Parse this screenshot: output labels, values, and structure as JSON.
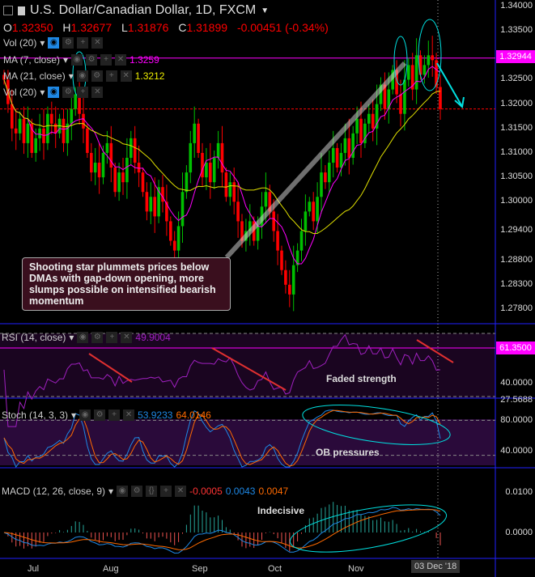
{
  "header": {
    "title": "U.S. Dollar/Canadian Dollar, 1D, FXCM",
    "open_label": "O",
    "open": "1.32350",
    "high_label": "H",
    "high": "1.32677",
    "low_label": "L",
    "low": "1.31876",
    "close_label": "C",
    "close": "1.31899",
    "change": "-0.00451 (-0.34%)"
  },
  "indicators": {
    "vol1": "Vol (20)",
    "ma7": "MA (7, close)",
    "ma7_val": "1.3259",
    "ma21": "MA (21, close)",
    "ma21_val": "1.3212",
    "vol2": "Vol (20)",
    "rsi": "RSI (14, close)",
    "rsi_val": "49.9004",
    "stoch": "Stoch (14, 3, 3)",
    "stoch_k": "53.9233",
    "stoch_d": "64.0146",
    "macd": "MACD (12, 26, close, 9)",
    "macd_hist": "-0.0005",
    "macd_line": "0.0043",
    "macd_signal": "0.0047"
  },
  "price_axis": [
    "1.34000",
    "1.33500",
    "1.32500",
    "1.32000",
    "1.31500",
    "1.31000",
    "1.30500",
    "1.30000",
    "1.29400",
    "1.28800",
    "1.28300",
    "1.27800"
  ],
  "price_tag": "1.32944",
  "rsi_axis": {
    "tag": "61.3500",
    "mid": "40.0000",
    "low": "27.5688"
  },
  "stoch_axis": [
    "80.0000",
    "40.0000"
  ],
  "macd_axis": [
    "0.0100",
    "0.0000"
  ],
  "time_axis": {
    "months": [
      "Jul",
      "Aug",
      "Sep",
      "Oct",
      "Nov"
    ],
    "cursor": "03 Dec '18"
  },
  "annotations": {
    "main": "Shooting star plummets prices below DMAs with gap-down opening, more slumps possible on intensified bearish momentum",
    "rsi": "Faded strength",
    "stoch": "OB pressures",
    "macd": "Indecisive"
  },
  "colors": {
    "up": "#00c000",
    "down": "#ff0000",
    "ma7": "#ff00ff",
    "ma21": "#e0e000",
    "rsi": "#a020c0",
    "stochK": "#1e88e5",
    "stochD": "#ff6a00",
    "ann": "#00e0e0",
    "arrow": "#e03030",
    "axis": "#2020ff"
  },
  "chart_data": {
    "type": "candlestick",
    "symbol": "USDCAD",
    "timeframe": "1D",
    "ylim": [
      1.278,
      1.34
    ],
    "closes": [
      1.325,
      1.32,
      1.315,
      1.314,
      1.317,
      1.312,
      1.316,
      1.31,
      1.313,
      1.315,
      1.312,
      1.318,
      1.316,
      1.314,
      1.317,
      1.312,
      1.316,
      1.319,
      1.322,
      1.318,
      1.315,
      1.31,
      1.306,
      1.308,
      1.305,
      1.31,
      1.312,
      1.307,
      1.302,
      1.306,
      1.304,
      1.309,
      1.313,
      1.308,
      1.306,
      1.302,
      1.298,
      1.301,
      1.297,
      1.303,
      1.3,
      1.296,
      1.292,
      1.29,
      1.295,
      1.302,
      1.306,
      1.312,
      1.316,
      1.31,
      1.305,
      1.308,
      1.304,
      1.309,
      1.312,
      1.306,
      1.301,
      1.304,
      1.3,
      1.296,
      1.292,
      1.294,
      1.296,
      1.292,
      1.295,
      1.299,
      1.302,
      1.298,
      1.294,
      1.29,
      1.286,
      1.283,
      1.281,
      1.287,
      1.29,
      1.294,
      1.298,
      1.3,
      1.296,
      1.301,
      1.306,
      1.304,
      1.308,
      1.311,
      1.307,
      1.31,
      1.313,
      1.309,
      1.314,
      1.317,
      1.312,
      1.316,
      1.318,
      1.315,
      1.32,
      1.324,
      1.319,
      1.323,
      1.327,
      1.322,
      1.318,
      1.325,
      1.328,
      1.323,
      1.33,
      1.326,
      1.328,
      1.33,
      1.329,
      1.3235,
      1.319
    ],
    "support_level": 1.319,
    "current_level": 1.32944
  }
}
